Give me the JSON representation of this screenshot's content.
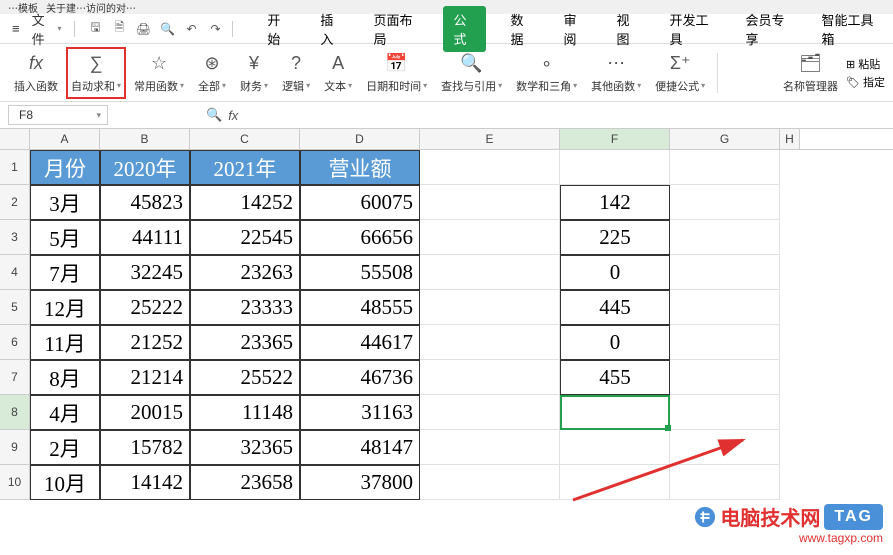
{
  "tabs": {
    "t2": "⋯模板",
    "t3": "关于建⋯访问的对⋯"
  },
  "menu": {
    "hamburger": "≡",
    "file": "文件",
    "mainTabs": [
      "开始",
      "插入",
      "页面布局",
      "公式",
      "数据",
      "审阅",
      "视图",
      "开发工具",
      "会员专享",
      "智能工具箱"
    ],
    "activeTab": "公式"
  },
  "ribbon": {
    "insertFn": "插入函数",
    "autoSum": "自动求和",
    "commonFn": "常用函数",
    "all": "全部",
    "finance": "财务",
    "logic": "逻辑",
    "text": "文本",
    "dateTime": "日期和时间",
    "lookup": "查找与引用",
    "mathTrig": "数学和三角",
    "otherFn": "其他函数",
    "quickFormula": "便捷公式",
    "nameMgr": "名称管理器",
    "paste": "粘贴",
    "define": "指定"
  },
  "nameBox": "F8",
  "cols": [
    "A",
    "B",
    "C",
    "D",
    "E",
    "F",
    "G",
    "H"
  ],
  "headerRow": {
    "A": "月份",
    "B": "2020年",
    "C": "2021年",
    "D": "营业额"
  },
  "rows": [
    {
      "n": 1
    },
    {
      "n": 2,
      "A": "3月",
      "B": "45823",
      "C": "14252",
      "D": "60075",
      "F": "142"
    },
    {
      "n": 3,
      "A": "5月",
      "B": "44111",
      "C": "22545",
      "D": "66656",
      "F": "225"
    },
    {
      "n": 4,
      "A": "7月",
      "B": "32245",
      "C": "23263",
      "D": "55508",
      "F": "0"
    },
    {
      "n": 5,
      "A": "12月",
      "B": "25222",
      "C": "23333",
      "D": "48555",
      "F": "445"
    },
    {
      "n": 6,
      "A": "11月",
      "B": "21252",
      "C": "23365",
      "D": "44617",
      "F": "0"
    },
    {
      "n": 7,
      "A": "8月",
      "B": "21214",
      "C": "25522",
      "D": "46736",
      "F": "455"
    },
    {
      "n": 8,
      "A": "4月",
      "B": "20015",
      "C": "11148",
      "D": "31163"
    },
    {
      "n": 9,
      "A": "2月",
      "B": "15782",
      "C": "32365",
      "D": "48147"
    },
    {
      "n": 10,
      "A": "10月",
      "B": "14142",
      "C": "23658",
      "D": "37800"
    }
  ],
  "watermark": {
    "brand": "电脑技术网",
    "url": "www.tagxp.com",
    "tag": "TAG"
  }
}
